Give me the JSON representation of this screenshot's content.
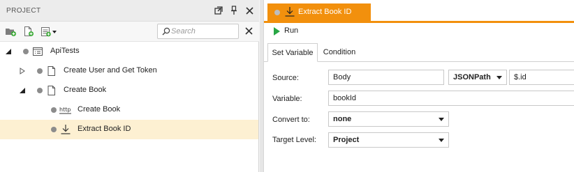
{
  "project_panel": {
    "title": "PROJECT",
    "search": {
      "placeholder": "Search",
      "value": ""
    },
    "tree": [
      {
        "label": "ApiTests",
        "icon": "api-test-icon",
        "expanded": true
      },
      {
        "label": "Create User and Get Token",
        "icon": "document-icon",
        "expanded": false
      },
      {
        "label": "Create Book",
        "icon": "document-icon",
        "expanded": true
      },
      {
        "label": "Create Book",
        "icon": "http-icon"
      },
      {
        "label": "Extract Book ID",
        "icon": "extract-icon",
        "selected": true
      }
    ]
  },
  "editor": {
    "tab_title": "Extract Book ID",
    "run_label": "Run",
    "tabs": [
      "Set Variable",
      "Condition"
    ],
    "active_tab": "Set Variable",
    "fields": {
      "source_label": "Source:",
      "source_value": "Body",
      "source_format": "JSONPath",
      "source_path": "$.id",
      "variable_label": "Variable:",
      "variable_value": "bookId",
      "convert_label": "Convert to:",
      "convert_value": "none",
      "target_label": "Target Level:",
      "target_value": "Project"
    }
  },
  "colors": {
    "accent": "#f2900d",
    "selection": "#fdf0d2",
    "run_green": "#28a745"
  }
}
